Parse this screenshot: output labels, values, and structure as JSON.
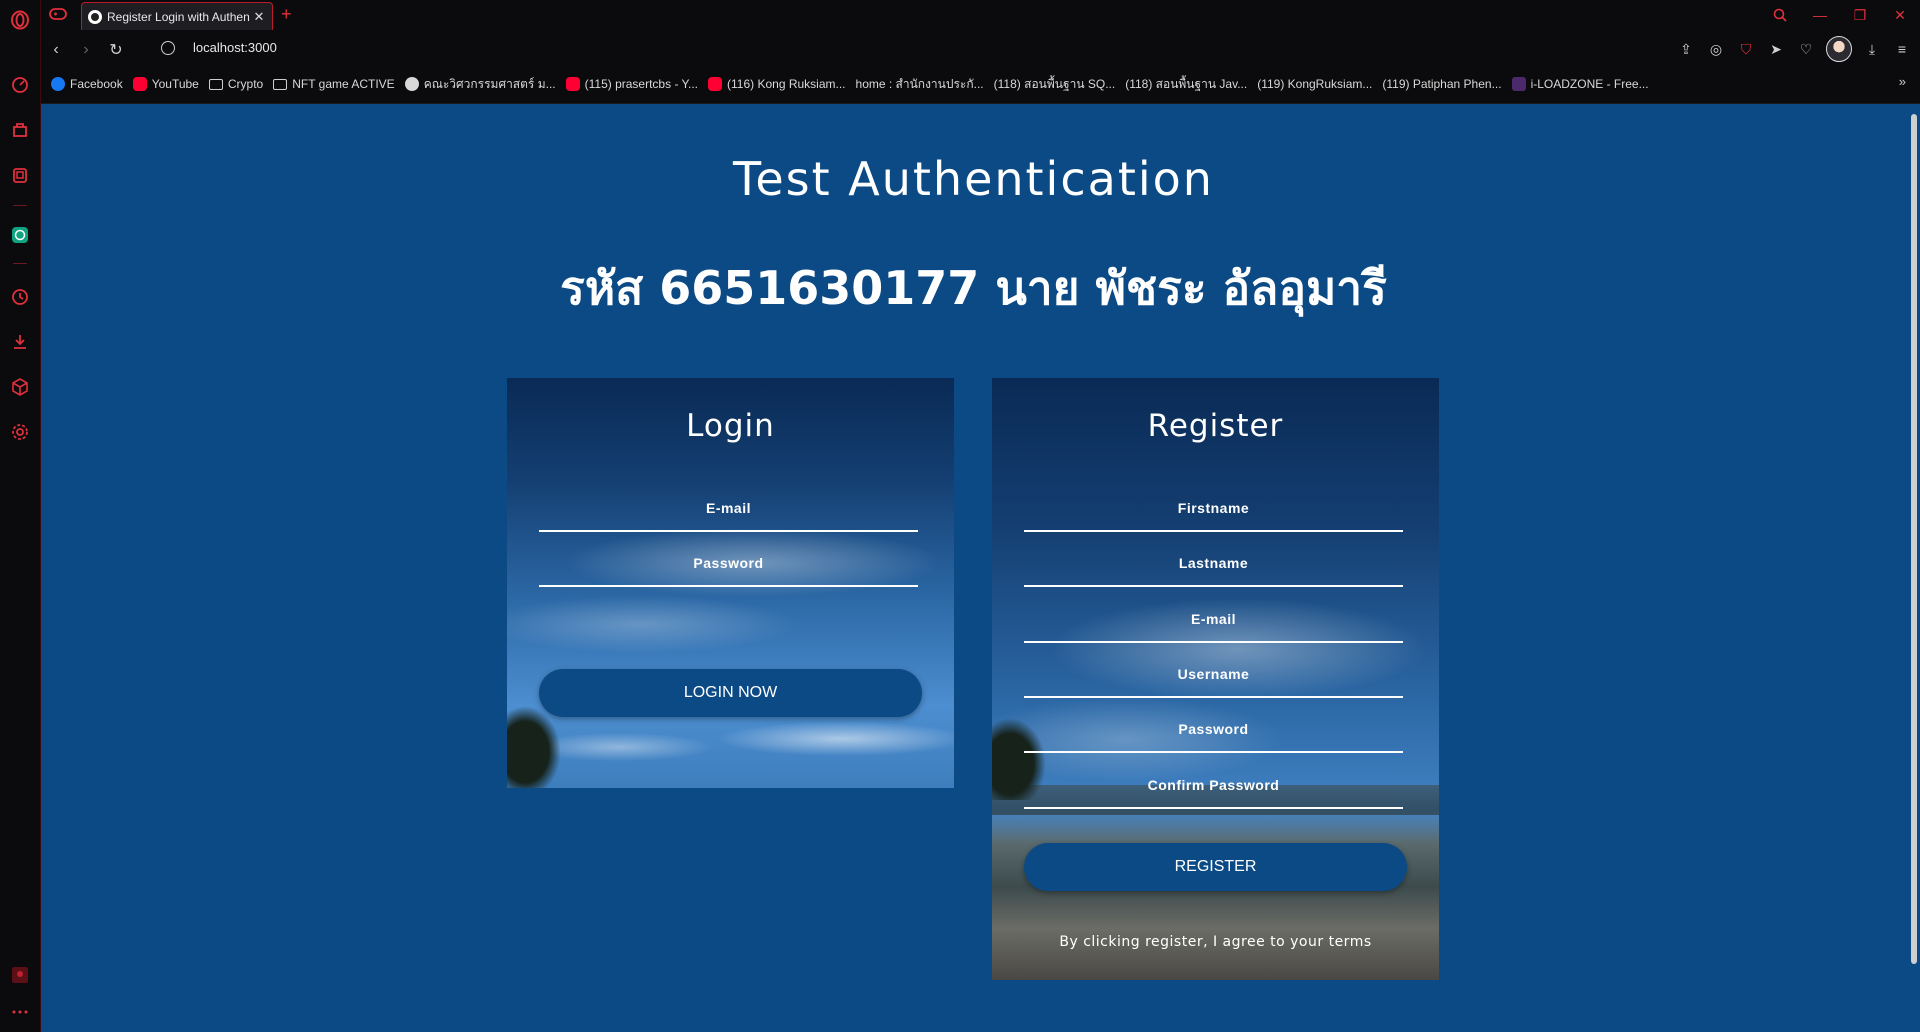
{
  "browser": {
    "tab_title": "Register Login with Authen",
    "url": "localhost:3000",
    "bookmarks": [
      {
        "label": "Facebook",
        "icon": "facebook-icon"
      },
      {
        "label": "YouTube",
        "icon": "youtube-icon"
      },
      {
        "label": "Crypto",
        "icon": "folder-icon"
      },
      {
        "label": "NFT game ACTIVE",
        "icon": "folder-icon"
      },
      {
        "label": "คณะวิศวกรรมศาสตร์ ม...",
        "icon": "wordpress-icon"
      },
      {
        "label": "(115) prasertcbs - Y...",
        "icon": "youtube-icon"
      },
      {
        "label": "(116) Kong Ruksiam...",
        "icon": "youtube-icon"
      },
      {
        "label": "home : สำนักงานประกั...",
        "icon": "page-icon"
      },
      {
        "label": "(118) สอนพื้นฐาน SQ...",
        "icon": "page-icon"
      },
      {
        "label": "(118) สอนพื้นฐาน Jav...",
        "icon": "page-icon"
      },
      {
        "label": "(119) KongRuksiam...",
        "icon": "page-icon"
      },
      {
        "label": "(119) Patiphan Phen...",
        "icon": "page-icon"
      },
      {
        "label": "i-LOADZONE - Free...",
        "icon": "iloadzone-icon"
      }
    ],
    "accent_color": "#e0303c"
  },
  "page": {
    "title": "Test Authentication",
    "subtitle": "รหัส 6651630177 นาย พัชระ อัลอุมารี",
    "background_color": "#0b4a85"
  },
  "login": {
    "heading": "Login",
    "email_placeholder": "E-mail",
    "password_placeholder": "Password",
    "button": "LOGIN NOW"
  },
  "register": {
    "heading": "Register",
    "firstname_placeholder": "Firstname",
    "lastname_placeholder": "Lastname",
    "email_placeholder": "E-mail",
    "username_placeholder": "Username",
    "password_placeholder": "Password",
    "confirm_placeholder": "Confirm Password",
    "button": "REGISTER",
    "terms": "By clicking register, I agree to your terms"
  }
}
